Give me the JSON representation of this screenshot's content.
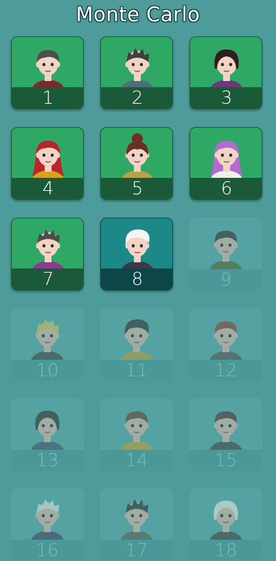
{
  "title": "Monte Carlo",
  "levels": [
    {
      "num": "1",
      "state": "unlocked",
      "hair": "#4d4d4d",
      "hair_style": "short",
      "shirt": "#7a2a2e",
      "skin": "#f2d4c4"
    },
    {
      "num": "2",
      "state": "unlocked",
      "hair": "#3f3f3f",
      "hair_style": "spiky",
      "shirt": "#4e6e78",
      "skin": "#f2d4c4"
    },
    {
      "num": "3",
      "state": "unlocked",
      "hair": "#2b2020",
      "hair_style": "bob",
      "shirt": "#6b3a7a",
      "skin": "#f2d4c4"
    },
    {
      "num": "4",
      "state": "unlocked",
      "hair": "#b8262a",
      "hair_style": "long",
      "shirt": "#d9a21d",
      "skin": "#f2d4c4"
    },
    {
      "num": "5",
      "state": "unlocked",
      "hair": "#6b2f25",
      "hair_style": "bun",
      "shirt": "#b5a24a",
      "skin": "#f2d4c4"
    },
    {
      "num": "6",
      "state": "unlocked",
      "hair": "#b46ad1",
      "hair_style": "long",
      "shirt": "#eeeeee",
      "skin": "#f2d4c4"
    },
    {
      "num": "7",
      "state": "unlocked",
      "hair": "#4d4d4d",
      "hair_style": "spiky",
      "shirt": "#8a3c8e",
      "skin": "#f2d4c4"
    },
    {
      "num": "8",
      "state": "selected",
      "hair": "#f4f4f4",
      "hair_style": "swoop",
      "shirt": "#3a3a4a",
      "skin": "#f2d4c4"
    },
    {
      "num": "9",
      "state": "locked",
      "hair": "#3a3a3a",
      "hair_style": "short",
      "shirt": "#5a6a3a",
      "skin": "#d9b8a8"
    },
    {
      "num": "10",
      "state": "locked",
      "hair": "#d9c060",
      "hair_style": "spiky",
      "shirt": "#4a4a4a",
      "skin": "#d9b8a8"
    },
    {
      "num": "11",
      "state": "locked",
      "hair": "#3a3a3a",
      "hair_style": "swoop",
      "shirt": "#b8a040",
      "skin": "#d9b8a8"
    },
    {
      "num": "12",
      "state": "locked",
      "hair": "#8a4a3a",
      "hair_style": "short",
      "shirt": "#5a5a5a",
      "skin": "#d9b8a8"
    },
    {
      "num": "13",
      "state": "locked",
      "hair": "#3a3a3a",
      "hair_style": "bob",
      "shirt": "#4a5a6a",
      "skin": "#d9b8a8"
    },
    {
      "num": "14",
      "state": "locked",
      "hair": "#6a4a3a",
      "hair_style": "short",
      "shirt": "#c0a040",
      "skin": "#d9b8a8"
    },
    {
      "num": "15",
      "state": "locked",
      "hair": "#5a3a3a",
      "hair_style": "short",
      "shirt": "#4a4a4a",
      "skin": "#d9b8a8"
    },
    {
      "num": "16",
      "state": "locked",
      "hair": "#e0e0e0",
      "hair_style": "spiky",
      "shirt": "#4a4a6a",
      "skin": "#d9b8a8"
    },
    {
      "num": "17",
      "state": "locked",
      "hair": "#3a3a3a",
      "hair_style": "spiky",
      "shirt": "#5a6a5a",
      "skin": "#d9b8a8"
    },
    {
      "num": "18",
      "state": "locked",
      "hair": "#e8e8e8",
      "hair_style": "bob",
      "shirt": "#4a4a4a",
      "skin": "#d9b8a8"
    }
  ]
}
